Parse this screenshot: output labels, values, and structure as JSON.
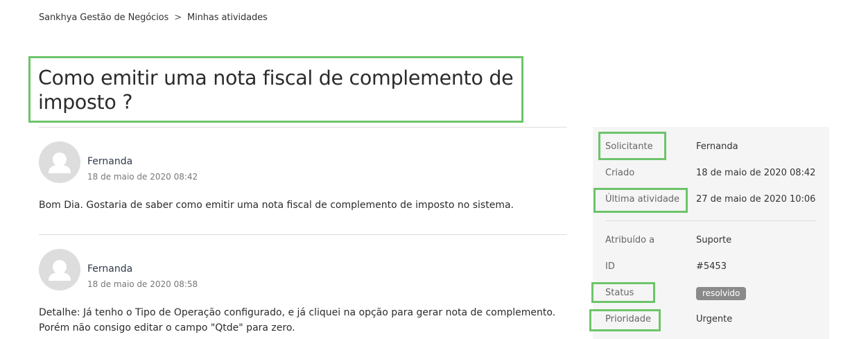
{
  "breadcrumb": {
    "root": "Sankhya Gestão de Negócios",
    "separator": ">",
    "current": "Minhas atividades"
  },
  "title": "Como emitir uma nota fiscal de complemento de imposto ?",
  "comments": [
    {
      "author": "Fernanda",
      "date": "18 de maio de 2020 08:42",
      "lines": [
        "Bom Dia. Gostaria de saber como emitir uma nota fiscal de complemento de imposto no sistema."
      ]
    },
    {
      "author": "Fernanda",
      "date": "18 de maio de 2020 08:58",
      "lines": [
        "Detalhe: Já tenho o Tipo de Operação configurado, e já cliquei na opção para gerar nota de complemento.",
        "Porém não consigo editar o campo \"Qtde\" para zero."
      ]
    }
  ],
  "properties": {
    "requester": {
      "label": "Solicitante",
      "value": "Fernanda"
    },
    "created": {
      "label": "Criado",
      "value": "18 de maio de 2020 08:42"
    },
    "last_activity": {
      "label": "Última atividade",
      "value": "27 de maio de 2020 10:06"
    },
    "assigned": {
      "label": "Atribuído a",
      "value": "Suporte"
    },
    "id": {
      "label": "ID",
      "value": "#5453"
    },
    "status": {
      "label": "Status",
      "value": "resolvido"
    },
    "priority": {
      "label": "Prioridade",
      "value": "Urgente"
    }
  },
  "colors": {
    "highlight": "#6dc46a",
    "badge_bg": "#8a8a8a",
    "sidebar_bg": "#f5f5f5"
  },
  "icons": {
    "avatar": "user-silhouette-icon"
  }
}
